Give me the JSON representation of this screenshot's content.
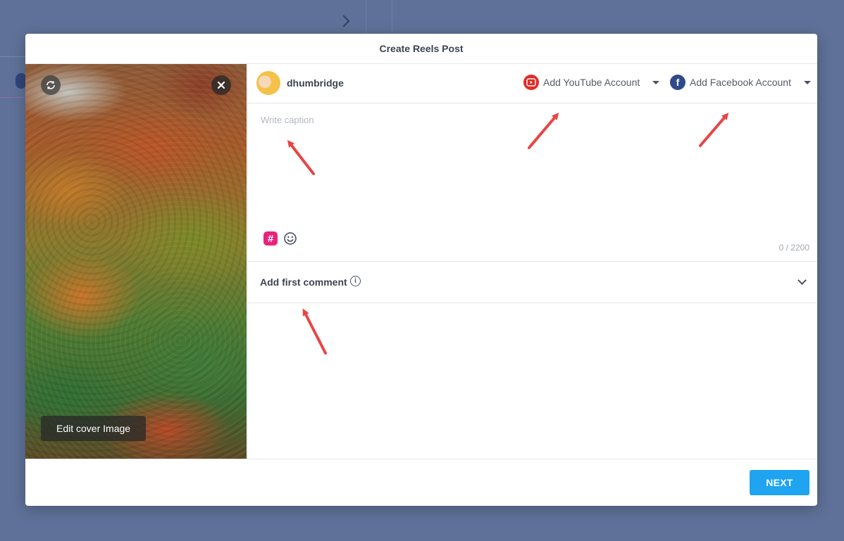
{
  "modal": {
    "title": "Create Reels Post"
  },
  "media": {
    "edit_cover_label": "Edit cover Image"
  },
  "account": {
    "username": "dhumbridge",
    "youtube_label": "Add YouTube Account",
    "facebook_label": "Add Facebook Account"
  },
  "caption": {
    "placeholder": "Write caption",
    "counter": "0 / 2200"
  },
  "first_comment": {
    "label": "Add first comment"
  },
  "footer": {
    "next_label": "NEXT"
  },
  "colors": {
    "youtube": "#e32b24",
    "facebook": "#2f4a8a",
    "hashtag": "#e8237a",
    "primary": "#1ea4f0",
    "annotation_arrow": "#e84545"
  }
}
